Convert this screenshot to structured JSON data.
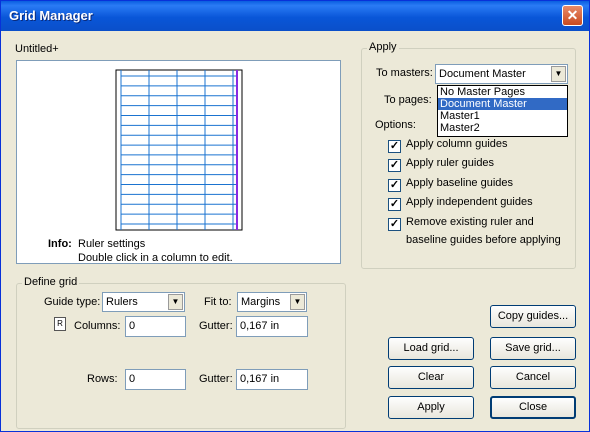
{
  "window": {
    "title": "Grid Manager",
    "close_glyph": "✕"
  },
  "preview": {
    "document_name": "Untitled+",
    "info_label": "Info:",
    "info_line1": "Ruler settings",
    "info_line2": "Double click in a column to edit.",
    "column_count": 4,
    "row_count": 15,
    "grid_color": "#1a73d0",
    "margin_color": "#8a2be2"
  },
  "apply_group": {
    "label": "Apply",
    "to_masters_label": "To masters:",
    "to_masters_value": "Document Master",
    "to_pages_label": "To pages:",
    "options_label": "Options:",
    "master_options": [
      "No Master Pages",
      "Document Master",
      "Master1",
      "Master2"
    ],
    "selected_option_index": 1,
    "checkboxes": [
      {
        "label": "Apply column guides",
        "checked": true
      },
      {
        "label": "Apply ruler guides",
        "checked": true
      },
      {
        "label": "Apply baseline guides",
        "checked": true
      },
      {
        "label": "Apply independent guides",
        "checked": true
      },
      {
        "label": "Remove existing ruler and",
        "label2": "baseline guides before applying",
        "checked": true
      }
    ]
  },
  "define_grid": {
    "label": "Define grid",
    "guide_type_label": "Guide type:",
    "guide_type_value": "Rulers",
    "fit_to_label": "Fit to:",
    "fit_to_value": "Margins",
    "columns_label": "Columns:",
    "columns_value": "0",
    "columns_gutter_label": "Gutter:",
    "columns_gutter_value": "0,167 in",
    "rows_label": "Rows:",
    "rows_value": "0",
    "rows_gutter_label": "Gutter:",
    "rows_gutter_value": "0,167 in"
  },
  "buttons": {
    "copy_guides": "Copy guides...",
    "load_grid": "Load grid...",
    "save_grid": "Save grid...",
    "clear": "Clear",
    "cancel": "Cancel",
    "apply": "Apply",
    "close": "Close"
  }
}
